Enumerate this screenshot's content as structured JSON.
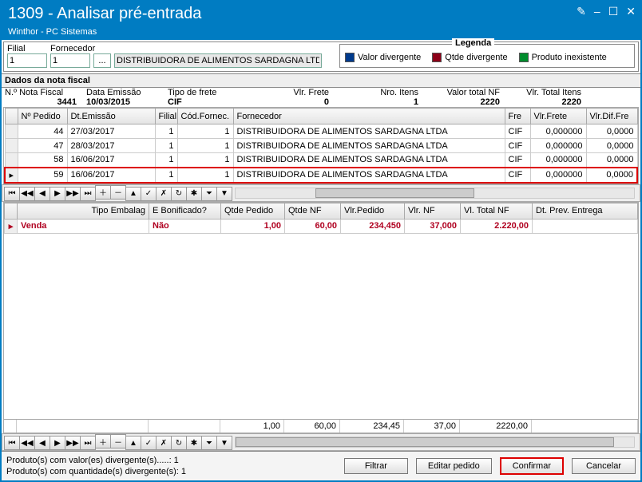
{
  "title": "1309 - Analisar pré-entrada",
  "subtitle": "Winthor - PC Sistemas",
  "window_controls": {
    "edit": "✎",
    "min": "–",
    "max": "☐",
    "close": "✕"
  },
  "top": {
    "filial_label": "Filial",
    "fornecedor_label": "Fornecedor",
    "filial_value": "1",
    "fornecedor_code": "1",
    "ellipsis": "...",
    "fornecedor_name": "DISTRIBUIDORA DE ALIMENTOS SARDAGNA LTDA"
  },
  "legend": {
    "title": "Legenda",
    "items": [
      {
        "label": "Valor divergente",
        "color": "#003a8c"
      },
      {
        "label": "Qtde divergente",
        "color": "#8c0018"
      },
      {
        "label": "Produto inexistente",
        "color": "#008c2d"
      }
    ]
  },
  "section_header": "Dados da nota fiscal",
  "nf": {
    "nro_nota_label": "N.º Nota Fiscal",
    "nro_nota": "3441",
    "data_emissao_label": "Data Emissão",
    "data_emissao": "10/03/2015",
    "tipo_frete_label": "Tipo de frete",
    "tipo_frete": "CIF",
    "vlr_frete_label": "Vlr. Frete",
    "vlr_frete": "0",
    "nro_itens_label": "Nro. Itens",
    "nro_itens": "1",
    "valor_total_nf_label": "Valor total NF",
    "valor_total_nf": "2220",
    "vlr_total_itens_label": "Vlr. Total Itens",
    "vlr_total_itens": "2220"
  },
  "grid1": {
    "headers": [
      "",
      "Nº Pedido",
      "Dt.Emissão",
      "Filial",
      "Cód.Fornec.",
      "Fornecedor",
      "Fre",
      "Vlr.Frete",
      "Vlr.Dif.Fre"
    ],
    "rows": [
      {
        "ind": "",
        "ped": "44",
        "dt": "27/03/2017",
        "fil": "1",
        "cod": "1",
        "forn": "DISTRIBUIDORA DE ALIMENTOS SARDAGNA LTDA",
        "fre": "CIF",
        "vfr": "0,000000",
        "vdif": "0,0000"
      },
      {
        "ind": "",
        "ped": "47",
        "dt": "28/03/2017",
        "fil": "1",
        "cod": "1",
        "forn": "DISTRIBUIDORA DE ALIMENTOS SARDAGNA LTDA",
        "fre": "CIF",
        "vfr": "0,000000",
        "vdif": "0,0000"
      },
      {
        "ind": "",
        "ped": "58",
        "dt": "16/06/2017",
        "fil": "1",
        "cod": "1",
        "forn": "DISTRIBUIDORA DE ALIMENTOS SARDAGNA LTDA",
        "fre": "CIF",
        "vfr": "0,000000",
        "vdif": "0,0000"
      },
      {
        "ind": "▸",
        "ped": "59",
        "dt": "16/06/2017",
        "fil": "1",
        "cod": "1",
        "forn": "DISTRIBUIDORA DE ALIMENTOS SARDAGNA LTDA",
        "fre": "CIF",
        "vfr": "0,000000",
        "vdif": "0,0000"
      }
    ]
  },
  "nav": {
    "b": [
      "⏮",
      "◀◀",
      "◀",
      "▶",
      "▶▶",
      "⏭",
      "＋",
      "－",
      "▲",
      "✓",
      "✗",
      "↻",
      "✱",
      "⏷",
      "▼"
    ]
  },
  "grid2": {
    "headers": [
      "",
      "Tipo Embalag",
      "E Bonificado?",
      "Qtde Pedido",
      "Qtde NF",
      "Vlr.Pedido",
      "Vlr. NF",
      "Vl. Total NF",
      "Dt. Prev. Entrega"
    ],
    "row": {
      "ind": "▸",
      "tipo": "Venda",
      "bon": "Não",
      "qped": "1,00",
      "qnf": "60,00",
      "vped": "234,450",
      "vnf": "37,000",
      "vtot": "2.220,00",
      "dt": ""
    },
    "totals": {
      "qped": "1,00",
      "qnf": "60,00",
      "vped": "234,45",
      "vnf": "37,00",
      "vtot": "2220,00"
    }
  },
  "footer": {
    "msg1": "Produto(s) com valor(es) divergente(s).....: 1",
    "msg2": "Produto(s) com quantidade(s) divergente(s): 1",
    "filtrar": "Filtrar",
    "editar": "Editar pedido",
    "confirmar": "Confirmar",
    "cancelar": "Cancelar"
  }
}
